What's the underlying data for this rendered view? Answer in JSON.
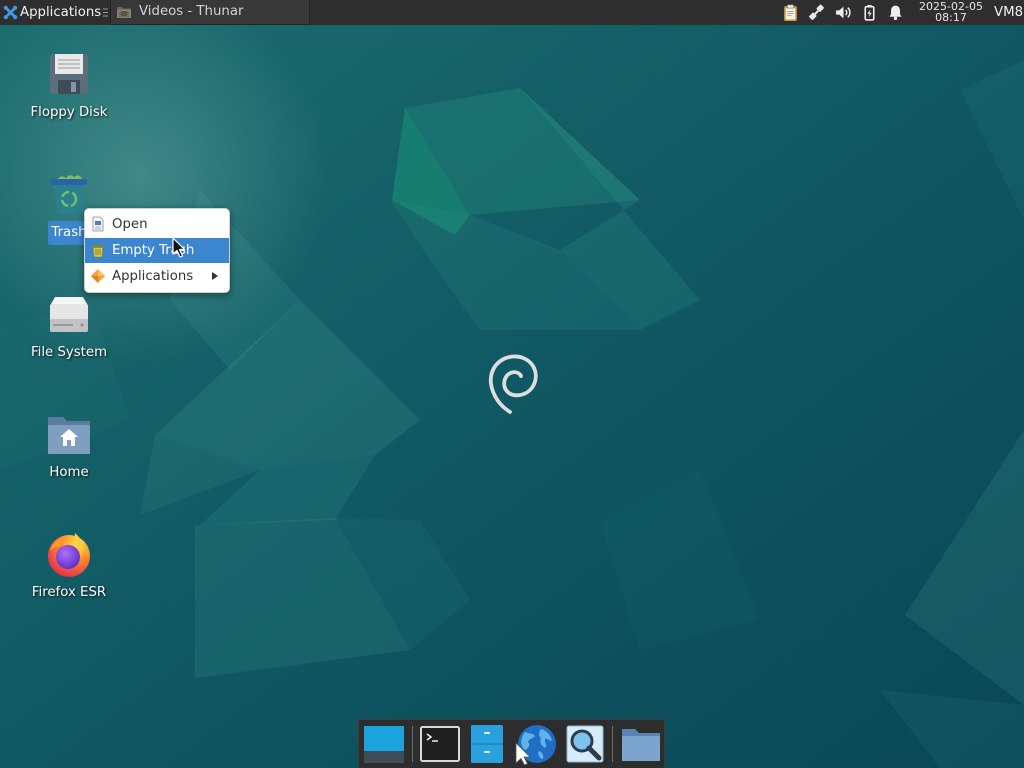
{
  "top_panel": {
    "applications_label": "Applications",
    "applications_icon": "xfce-logo-icon",
    "window_buttons": [
      {
        "label": "Videos - Thunar",
        "icon": "videos-folder-icon",
        "active": false
      }
    ],
    "tray_icons": [
      "clipboard-icon",
      "network-wired-icon",
      "volume-icon",
      "battery-charging-icon",
      "notification-bell-icon"
    ],
    "clock": {
      "date": "2025-02-05",
      "time": "08:17"
    },
    "user_label": "VM8"
  },
  "desktop": {
    "icons": [
      {
        "label": "Floppy Disk",
        "icon": "floppy-disk-icon",
        "selected": false
      },
      {
        "label": "Trash",
        "icon": "trash-full-icon",
        "selected": true
      },
      {
        "label": "File System",
        "icon": "hard-drive-icon",
        "selected": false
      },
      {
        "label": "Home",
        "icon": "home-folder-icon",
        "selected": false
      },
      {
        "label": "Firefox ESR",
        "icon": "firefox-icon",
        "selected": false
      }
    ],
    "center_logo": "debian-swirl-icon"
  },
  "context_menu": {
    "items": [
      {
        "label": "Open",
        "icon": "open-document-icon",
        "highlighted": false,
        "has_submenu": false
      },
      {
        "label": "Empty Trash",
        "icon": "empty-trash-icon",
        "highlighted": true,
        "has_submenu": false
      },
      {
        "label": "Applications",
        "icon": "applications-icon",
        "highlighted": false,
        "has_submenu": true
      }
    ]
  },
  "dock": {
    "items": [
      {
        "icon": "show-desktop-icon"
      },
      {
        "icon": "terminal-icon"
      },
      {
        "icon": "file-manager-icon"
      },
      {
        "icon": "web-browser-icon"
      },
      {
        "icon": "app-finder-icon"
      },
      {
        "icon": "folder-icon"
      }
    ]
  },
  "theme": {
    "panel_bg": "#2f2f2f",
    "selection_blue": "#3b86cf",
    "menu_bg": "#ffffff",
    "wallpaper_teal": "#0f5863"
  }
}
